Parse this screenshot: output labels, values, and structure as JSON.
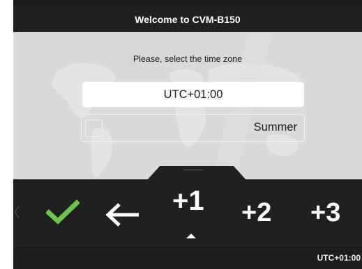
{
  "header": {
    "title": "Welcome to CVM-B150"
  },
  "main": {
    "prompt": "Please, select the time zone",
    "selected_timezone": "UTC+01:00",
    "summer": {
      "label": "Summer",
      "checked": false
    }
  },
  "picker": {
    "options": [
      "+1",
      "+2",
      "+3"
    ],
    "selected_index": 0
  },
  "status": {
    "timezone": "UTC+01:00"
  },
  "colors": {
    "accent": "#6cc64a",
    "panel": "#202020",
    "background": "#d9d9d9"
  },
  "icons": {
    "confirm": "checkmark-icon",
    "back": "arrow-left-icon",
    "scroll": "chevron-left-icon",
    "selector": "caret-up-icon"
  }
}
